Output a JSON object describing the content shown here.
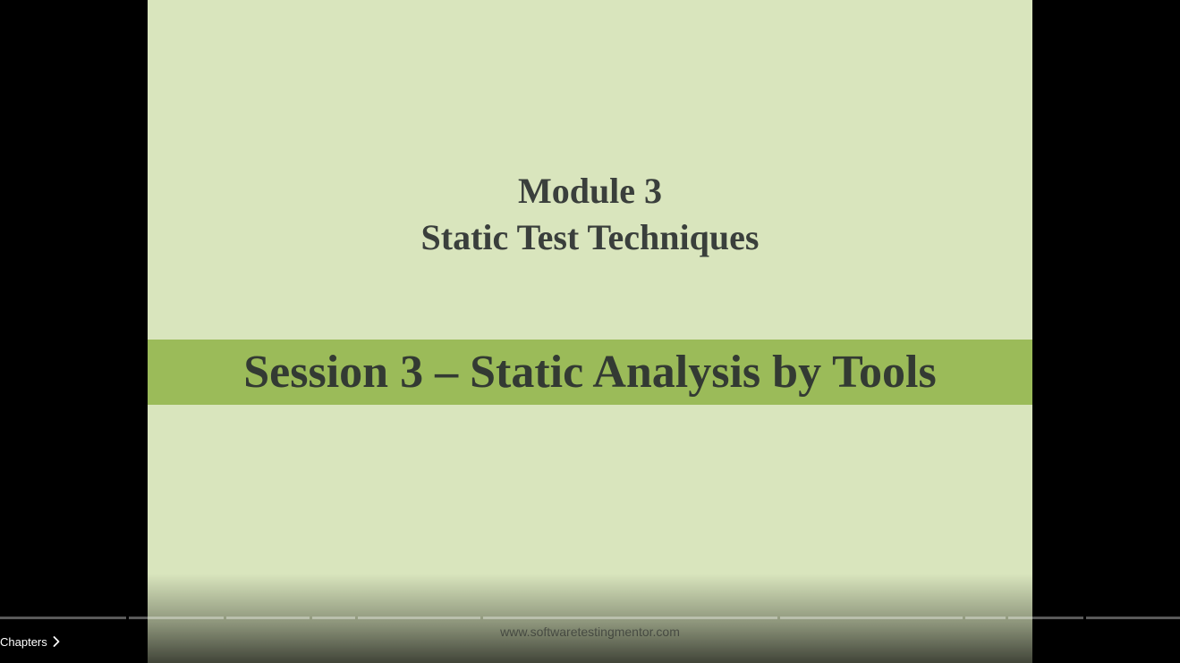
{
  "slide": {
    "module_line1": "Module 3",
    "module_line2": "Static Test Techniques",
    "session_title": "Session 3 – Static Analysis by Tools",
    "watermark": "www.softwaretestingmentor.com"
  },
  "player": {
    "chapters_label": "Chapters",
    "chapters_icon": "chevron-right-icon"
  },
  "colors": {
    "slide_background": "#d9e5bd",
    "session_band": "#9bbb59",
    "title_text": "#3a3f3c"
  }
}
